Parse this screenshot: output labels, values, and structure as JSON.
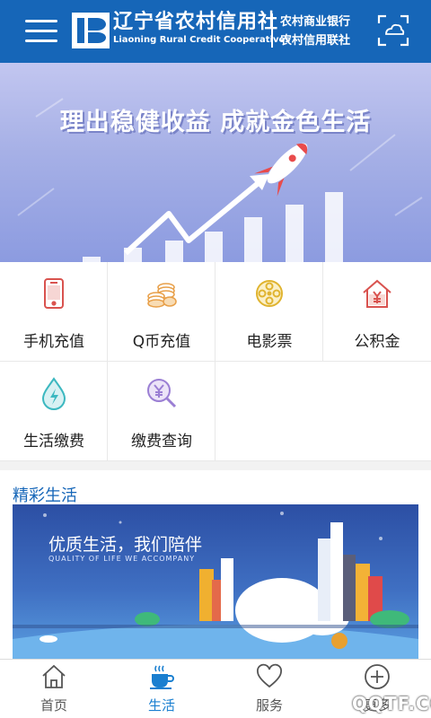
{
  "header": {
    "brand_cn": "辽宁省农村信用社",
    "brand_en": "Liaoning Rural Credit Cooperatives",
    "slogan_line1": "农村商业银行",
    "slogan_line2": "农村信用联社",
    "icons": {
      "menu": "menu-icon",
      "logo": "bank-logo",
      "scan": "scan-icon"
    }
  },
  "banner": {
    "title": "理出稳健收益  成就金色生活"
  },
  "services": [
    {
      "label": "手机充值",
      "icon": "phone-icon"
    },
    {
      "label": "Q币充值",
      "icon": "coins-icon"
    },
    {
      "label": "电影票",
      "icon": "film-reel-icon"
    },
    {
      "label": "公积金",
      "icon": "house-yuan-icon"
    },
    {
      "label": "生活缴费",
      "icon": "drop-lightning-icon"
    },
    {
      "label": "缴费查询",
      "icon": "yuan-search-icon"
    }
  ],
  "section": {
    "title": "精彩生活",
    "promo": {
      "title": "优质生活，我们陪伴",
      "subtitle": "QUALITY OF LIFE WE ACCOMPANY"
    }
  },
  "tabs": [
    {
      "label": "首页",
      "icon": "home-icon",
      "active": false
    },
    {
      "label": "生活",
      "icon": "coffee-cup-icon",
      "active": true
    },
    {
      "label": "服务",
      "icon": "heart-icon",
      "active": false
    },
    {
      "label": "更多",
      "icon": "plus-circle-icon",
      "active": false
    }
  ],
  "watermark": "QQTF.COM",
  "colors": {
    "header_bg": "#1666b8",
    "accent_blue": "#1a7fd0",
    "section_title": "#1666b8",
    "icon_red": "#d9534f",
    "icon_orange": "#e8a04a",
    "icon_yellow": "#e0b430",
    "icon_teal": "#3cb8c0",
    "icon_purple": "#9b7fd4"
  }
}
